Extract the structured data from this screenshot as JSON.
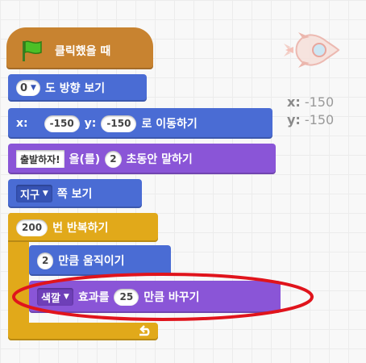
{
  "colors": {
    "motion": "#4a6cd4",
    "looks": "#8a55d7",
    "control": "#e1a91a",
    "events": "#c88330",
    "highlight": "#e0141c"
  },
  "hat": {
    "icon": "green-flag-icon",
    "label": "클릭했을 때"
  },
  "point_direction": {
    "value": "0",
    "label": "도 방향 보기"
  },
  "goto": {
    "x_label": "x:",
    "x_value": "-150",
    "y_label": "y:",
    "y_value": "-150",
    "suffix": "로 이동하기"
  },
  "say_for": {
    "message": "출발하자!",
    "mid": "을(를)",
    "seconds": "2",
    "suffix": "초동안 말하기"
  },
  "point_towards": {
    "target": "지구",
    "suffix": "쪽 보기"
  },
  "repeat": {
    "count": "200",
    "label": "번 반복하기"
  },
  "move": {
    "steps": "2",
    "label": "만큼 움직이기"
  },
  "change_effect": {
    "effect": "색깔",
    "mid": "효과를",
    "amount": "25",
    "suffix": "만큼 바꾸기"
  },
  "sprite_position": {
    "x_label": "x:",
    "x_value": "-150",
    "y_label": "y:",
    "y_value": "-150"
  },
  "sprite": {
    "icon": "rocket-sprite-icon"
  }
}
